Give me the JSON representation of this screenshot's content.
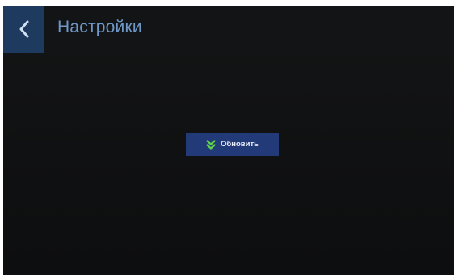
{
  "header": {
    "back_icon": "chevron-left-icon",
    "title": "Настройки"
  },
  "main": {
    "update_button": {
      "icon": "double-chevron-down-icon",
      "label": "Обновить"
    }
  },
  "colors": {
    "accent": "#1f3a5f",
    "title_text": "#6f97c8",
    "button_bg": "#233a78",
    "icon_green": "#5fd34a"
  }
}
